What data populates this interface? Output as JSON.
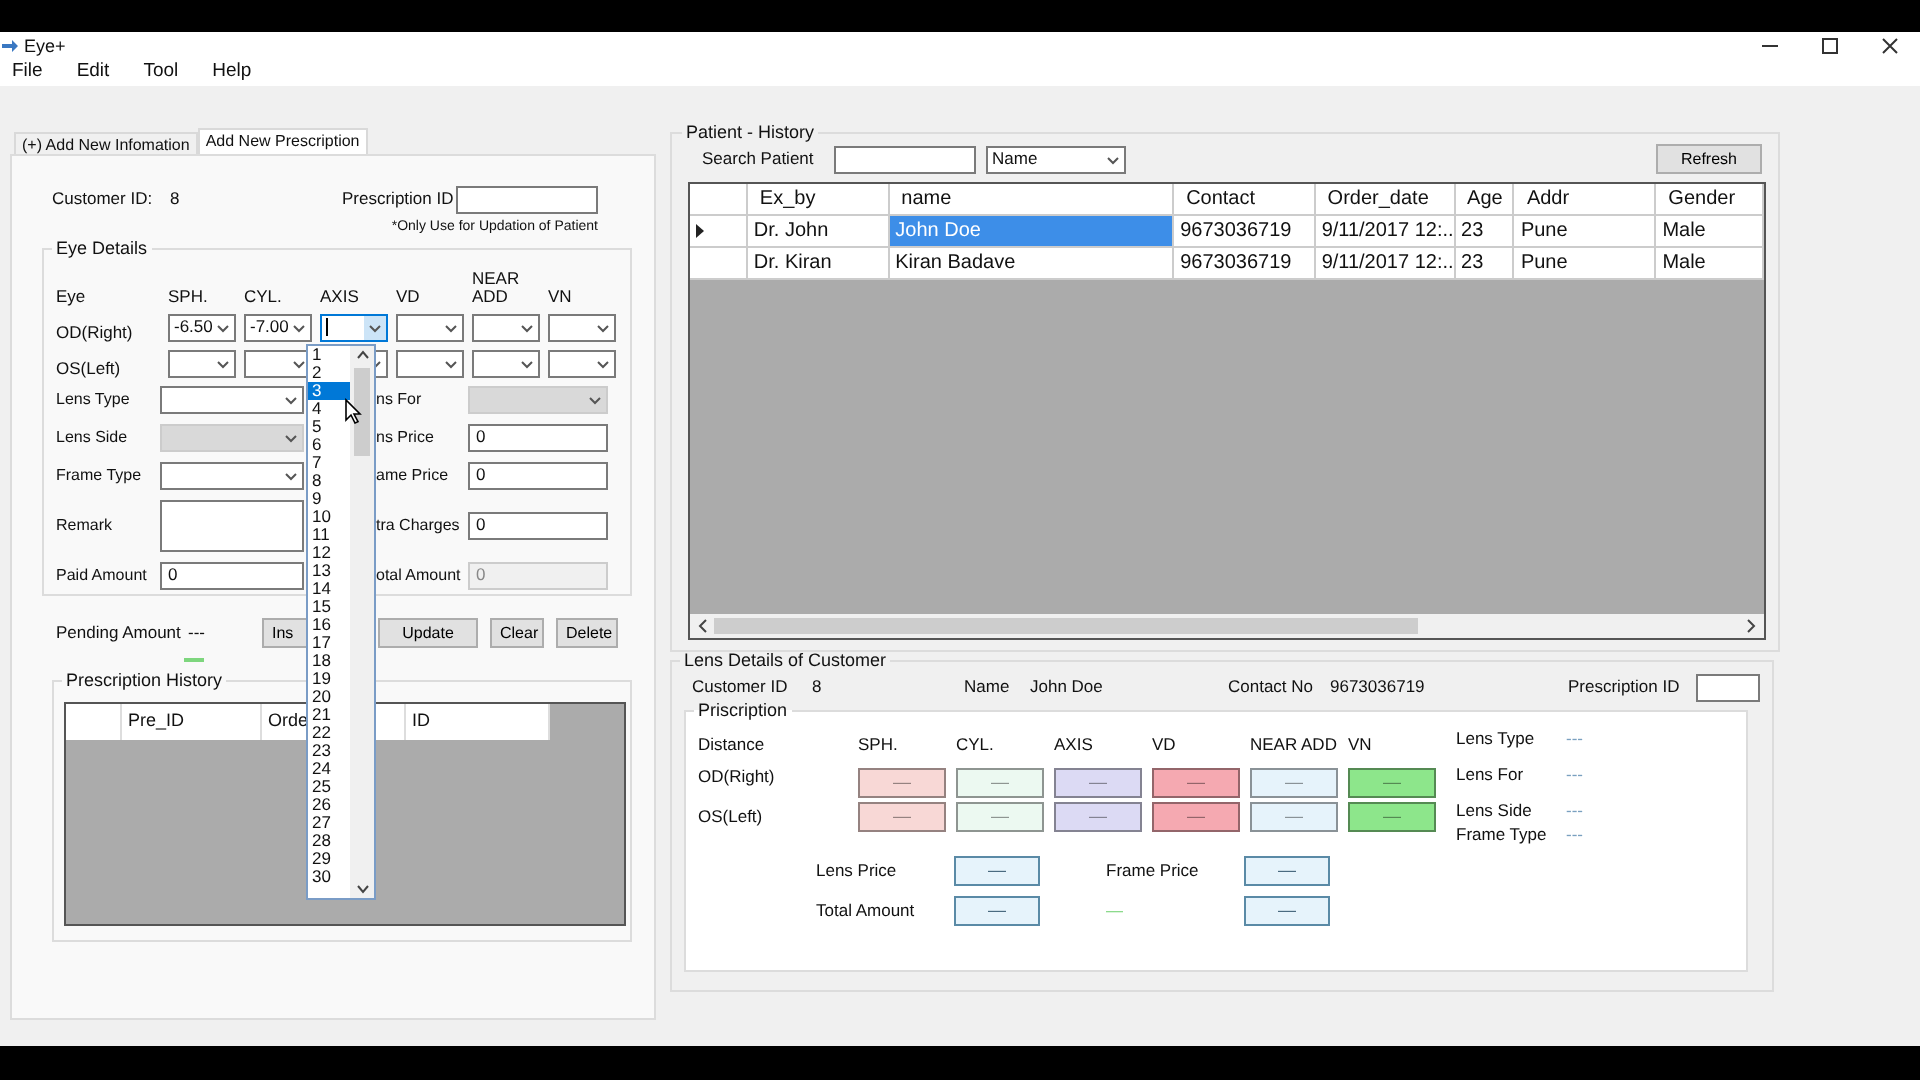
{
  "window": {
    "title": "Eye+"
  },
  "menu": [
    "File",
    "Edit",
    "Tool",
    "Help"
  ],
  "tabs": [
    {
      "label": "(+) Add New Infomation",
      "selected": false
    },
    {
      "label": "Add New Prescription",
      "selected": true
    }
  ],
  "prescription_form": {
    "customer_id_label": "Customer ID:",
    "customer_id": "8",
    "prescription_id_label": "Prescription ID",
    "prescription_id_note": "*Only Use for Updation of Patient",
    "eye_details": {
      "title": "Eye Details",
      "columns": [
        "Eye",
        "SPH.",
        "CYL.",
        "AXIS",
        "VD",
        "NEAR ADD",
        "VN"
      ],
      "rows": [
        {
          "label": "OD(Right)",
          "combos": [
            {
              "value": "-6.50",
              "open": false
            },
            {
              "value": "-7.00",
              "open": false
            },
            {
              "open": true
            },
            {
              "open": false
            },
            {
              "open": false
            },
            {
              "open": false
            }
          ]
        },
        {
          "label": "OS(Left)",
          "combos": [
            {
              "open": false
            },
            {
              "open": false
            },
            {
              "open": false
            },
            {
              "open": false
            },
            {
              "open": false
            },
            {
              "open": false
            }
          ]
        }
      ]
    },
    "detail_rows": [
      {
        "left": {
          "label": "Lens Type",
          "kind": "combo",
          "disabled": false
        },
        "right": {
          "label": "ns For",
          "kind": "combo",
          "disabled": true
        }
      },
      {
        "left": {
          "label": "Lens Side",
          "kind": "combo",
          "disabled": true
        },
        "right": {
          "label": "ns Price",
          "kind": "text",
          "value": "0",
          "disabled": false
        }
      },
      {
        "left": {
          "label": "Frame Type",
          "kind": "combo",
          "disabled": false
        },
        "right": {
          "label": "ame Price",
          "kind": "text",
          "value": "0",
          "disabled": false
        }
      },
      {
        "left": {
          "label": "Remark",
          "kind": "textarea",
          "disabled": false
        },
        "right": {
          "label": "tra Charges",
          "kind": "text",
          "value": "0",
          "disabled": false
        }
      },
      {
        "left": {
          "label": "Paid Amount",
          "kind": "text",
          "value": "0",
          "disabled": false
        },
        "right": {
          "label": "otal Amount",
          "kind": "text",
          "value": "0",
          "disabled": true
        }
      }
    ],
    "pending_amount_label": "Pending Amount",
    "pending_amount": "---",
    "buttons": [
      "Ins",
      "Update",
      "Clear",
      "Delete"
    ],
    "history": {
      "title": "Prescription History",
      "columns": [
        "Pre_ID",
        "Orde",
        "ID"
      ]
    },
    "axis_dropdown": {
      "items": [
        {
          "label": "1",
          "selected": false
        },
        {
          "label": "2",
          "selected": false
        },
        {
          "label": "3",
          "selected": true
        },
        {
          "label": "4",
          "selected": false
        },
        {
          "label": "5",
          "selected": false
        },
        {
          "label": "6",
          "selected": false
        },
        {
          "label": "7",
          "selected": false
        },
        {
          "label": "8",
          "selected": false
        },
        {
          "label": "9",
          "selected": false
        },
        {
          "label": "10",
          "selected": false
        },
        {
          "label": "11",
          "selected": false
        },
        {
          "label": "12",
          "selected": false
        },
        {
          "label": "13",
          "selected": false
        },
        {
          "label": "14",
          "selected": false
        },
        {
          "label": "15",
          "selected": false
        },
        {
          "label": "16",
          "selected": false
        },
        {
          "label": "17",
          "selected": false
        },
        {
          "label": "18",
          "selected": false
        },
        {
          "label": "19",
          "selected": false
        },
        {
          "label": "20",
          "selected": false
        },
        {
          "label": "21",
          "selected": false
        },
        {
          "label": "22",
          "selected": false
        },
        {
          "label": "23",
          "selected": false
        },
        {
          "label": "24",
          "selected": false
        },
        {
          "label": "25",
          "selected": false
        },
        {
          "label": "26",
          "selected": false
        },
        {
          "label": "27",
          "selected": false
        },
        {
          "label": "28",
          "selected": false
        },
        {
          "label": "29",
          "selected": false
        },
        {
          "label": "30",
          "selected": false
        }
      ]
    }
  },
  "patient_history": {
    "title": "Patient - History",
    "search_label": "Search Patient",
    "search_by": "Name",
    "refresh": "Refresh",
    "columns": [
      "Ex_by",
      "name",
      "Contact",
      "Order_date",
      "Age",
      "Addr",
      "Gender"
    ],
    "rows": [
      {
        "current": true,
        "cells": [
          {
            "text": "Dr. John",
            "selected": false
          },
          {
            "text": "John Doe",
            "selected": true
          },
          {
            "text": "9673036719",
            "selected": false
          },
          {
            "text": "9/11/2017 12:...",
            "selected": false
          },
          {
            "text": "23",
            "selected": false
          },
          {
            "text": "Pune",
            "selected": false
          },
          {
            "text": "Male",
            "selected": false
          }
        ]
      },
      {
        "current": false,
        "cells": [
          {
            "text": "Dr. Kiran",
            "selected": false
          },
          {
            "text": "Kiran Badave",
            "selected": false
          },
          {
            "text": "9673036719",
            "selected": false
          },
          {
            "text": "9/11/2017 12:...",
            "selected": false
          },
          {
            "text": "23",
            "selected": false
          },
          {
            "text": "Pune",
            "selected": false
          },
          {
            "text": "Male",
            "selected": false
          }
        ]
      }
    ]
  },
  "lens_details": {
    "title": "Lens Details of Customer",
    "info": [
      {
        "label": "Customer ID",
        "value": "8"
      },
      {
        "label": "Name",
        "value": "John Doe"
      },
      {
        "label": "Contact No",
        "value": "9673036719"
      }
    ],
    "prescription_id_label": "Prescription ID",
    "priscription": {
      "title": "Priscription",
      "distance_label": "Distance",
      "columns": [
        {
          "label": "SPH.",
          "color": "#f8d8d6"
        },
        {
          "label": "CYL.",
          "color": "#ecf9f1"
        },
        {
          "label": "AXIS",
          "color": "#dcdaf4"
        },
        {
          "label": "VD",
          "color": "#f5a9b1"
        },
        {
          "label": "NEAR ADD",
          "color": "#e6f3fb"
        },
        {
          "label": "VN",
          "color": "#8de68b"
        }
      ],
      "rows": [
        {
          "label": "OD(Right)",
          "values": [
            "—",
            "—",
            "—",
            "—",
            "—",
            "—"
          ]
        },
        {
          "label": "OS(Left)",
          "values": [
            "—",
            "—",
            "—",
            "—",
            "—",
            "—"
          ]
        }
      ],
      "lens_info": [
        {
          "label": "Lens Type",
          "value": "---"
        },
        {
          "label": "Lens For",
          "value": "---"
        },
        {
          "label": "Lens Side",
          "value": "---"
        },
        {
          "label": "Frame Type",
          "value": "---"
        }
      ],
      "prices": [
        {
          "kind": "label",
          "text": "Lens Price"
        },
        {
          "kind": "box",
          "text": "—"
        },
        {
          "kind": "label",
          "text": "Frame Price"
        },
        {
          "kind": "box",
          "text": "—"
        },
        {
          "kind": "label",
          "text": "Total Amount"
        },
        {
          "kind": "box",
          "text": "—"
        },
        {
          "kind": "note",
          "text": "—"
        },
        {
          "kind": "box",
          "text": "—"
        }
      ]
    }
  }
}
